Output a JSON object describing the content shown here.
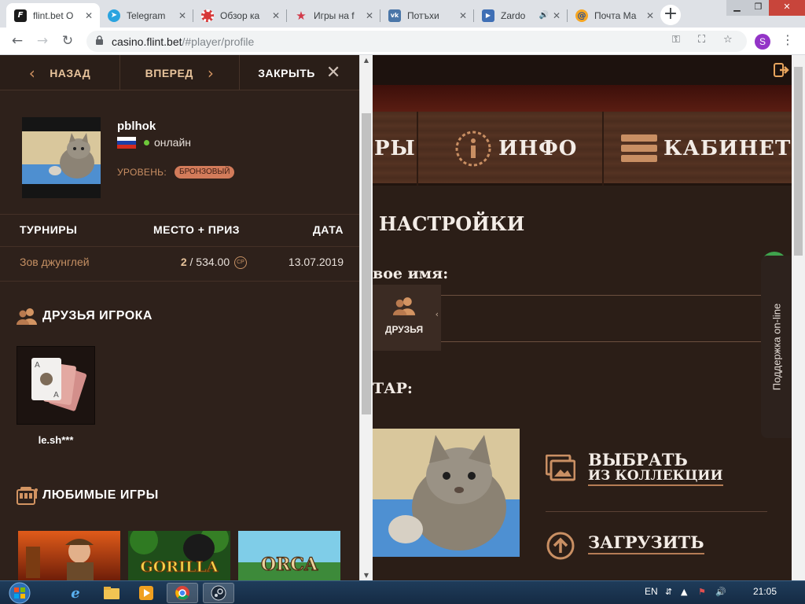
{
  "browser": {
    "tabs": [
      {
        "title": "flint.bet О",
        "icon": "flint-logo-icon",
        "active": true
      },
      {
        "title": "Telegram",
        "icon": "telegram-icon"
      },
      {
        "title": "Обзор ка",
        "icon": "casino-chip-icon"
      },
      {
        "title": "Игры на f",
        "icon": "star-icon"
      },
      {
        "title": "Потъхи",
        "icon": "vk-icon"
      },
      {
        "title": "Zardo",
        "icon": "play-icon",
        "audio": true
      },
      {
        "title": "Почта Ма",
        "icon": "mail-at-icon"
      }
    ],
    "new_tab": "+",
    "url_host": "casino.flint.bet",
    "url_path": "/#player/profile",
    "profile_initial": "S",
    "colors": {
      "tabstrip": "#dee1e6",
      "active_tab": "#ffffff"
    }
  },
  "panel": {
    "nav": {
      "back": "НАЗАД",
      "forward": "ВПЕРЕД",
      "close": "ЗАКРЫТЬ"
    },
    "player": {
      "name": "pblhok",
      "status": "онлайн",
      "level_label": "УРОВЕНЬ:",
      "level_value": "БРОНЗОВЫЙ",
      "country_flag": "russia-flag"
    },
    "tournaments": {
      "headers": [
        "ТУРНИРЫ",
        "МЕСТО + ПРИЗ",
        "ДАТА"
      ],
      "rows": [
        {
          "game": "Зов джунглей",
          "place": "2",
          "prize": " / 534.00",
          "currency": "CP",
          "date": "13.07.2019"
        }
      ]
    },
    "friends": {
      "title": "ДРУЗЬЯ ИГРОКА",
      "items": [
        {
          "name": "le.sh***"
        }
      ]
    },
    "favorites": {
      "title": "ЛЮБИМЫЕ ИГРЫ",
      "games": [
        "Book of Ra",
        "GORILLA",
        "ORCA"
      ]
    },
    "colors": {
      "bg": "#2e211b",
      "accent": "#e7c39b",
      "link": "#c59063",
      "badge": "#d27b5a"
    }
  },
  "site": {
    "nav": {
      "partial": "РЫ",
      "info": "ИНФО",
      "cabinet": "КАБИНЕТ"
    },
    "settings": {
      "heading": "НАСТРОЙКИ",
      "name_label": "вое имя:",
      "avatar_label": "ТАР:",
      "friends_tab": "ДРУЗЬЯ",
      "choose_line1": "ВЫБРАТЬ",
      "choose_line2": "ИЗ КОЛЛЕКЦИИ",
      "upload": "ЗАГРУЗИТЬ"
    },
    "support": "Поддержка on-line",
    "colors": {
      "online_green": "#3fa34d"
    }
  },
  "taskbar": {
    "apps": [
      "windows-start-icon",
      "ie-icon",
      "explorer-folder-icon",
      "media-player-icon",
      "chrome-icon",
      "steam-icon"
    ],
    "lang": "EN",
    "time": "21:05"
  }
}
